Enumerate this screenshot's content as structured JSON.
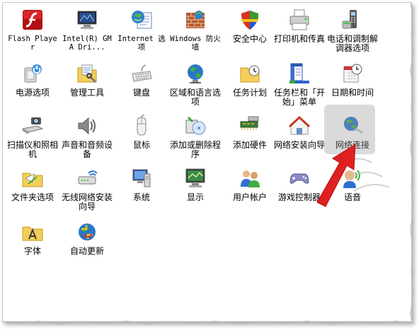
{
  "colors": {
    "highlight": "#9c9c9c",
    "arrow": "#e02020",
    "border": "#c9c9c9"
  },
  "items": [
    {
      "label": "Flash Player",
      "icon": "flash-icon",
      "mono": true
    },
    {
      "label": "Intel(R) GMA Dri...",
      "icon": "intel-gma-icon",
      "mono": true
    },
    {
      "label": "Internet 选项",
      "icon": "internet-options-icon",
      "mono": true
    },
    {
      "label": "Windows 防火墙",
      "icon": "firewall-icon",
      "mono": true
    },
    {
      "label": "安全中心",
      "icon": "security-center-icon",
      "mono": false
    },
    {
      "label": "打印机和传真",
      "icon": "printer-icon",
      "mono": false
    },
    {
      "label": "电话和调制解调器选项",
      "icon": "phone-modem-icon",
      "mono": false
    },
    {
      "label": "电源选项",
      "icon": "power-options-icon",
      "mono": false
    },
    {
      "label": "管理工具",
      "icon": "admin-tools-icon",
      "mono": false
    },
    {
      "label": "键盘",
      "icon": "keyboard-icon",
      "mono": false
    },
    {
      "label": "区域和语言选项",
      "icon": "region-language-icon",
      "mono": false
    },
    {
      "label": "任务计划",
      "icon": "scheduled-tasks-icon",
      "mono": false
    },
    {
      "label": "任务栏和「开始」菜单",
      "icon": "taskbar-start-icon",
      "mono": false
    },
    {
      "label": "日期和时间",
      "icon": "date-time-icon",
      "mono": false
    },
    {
      "label": "扫描仪和照相机",
      "icon": "scanner-camera-icon",
      "mono": false
    },
    {
      "label": "声音和音频设备",
      "icon": "sound-icon",
      "mono": false
    },
    {
      "label": "鼠标",
      "icon": "mouse-icon",
      "mono": false
    },
    {
      "label": "添加或删除程序",
      "icon": "add-remove-programs-icon",
      "mono": false
    },
    {
      "label": "添加硬件",
      "icon": "add-hardware-icon",
      "mono": false
    },
    {
      "label": "网络安装向导",
      "icon": "network-setup-wizard-icon",
      "mono": false
    },
    {
      "label": "网络连接",
      "icon": "network-connections-icon",
      "mono": false,
      "selected": true
    },
    {
      "label": "文件夹选项",
      "icon": "folder-options-icon",
      "mono": false
    },
    {
      "label": "无线网络安装向导",
      "icon": "wireless-setup-icon",
      "mono": false
    },
    {
      "label": "系统",
      "icon": "system-icon",
      "mono": false
    },
    {
      "label": "显示",
      "icon": "display-icon",
      "mono": false
    },
    {
      "label": "用户帐户",
      "icon": "user-accounts-icon",
      "mono": false
    },
    {
      "label": "游戏控制器",
      "icon": "game-controller-icon",
      "mono": false
    },
    {
      "label": "语音",
      "icon": "speech-icon",
      "mono": false
    },
    {
      "label": "字体",
      "icon": "fonts-icon",
      "mono": false
    },
    {
      "label": "自动更新",
      "icon": "automatic-updates-icon",
      "mono": false
    }
  ]
}
